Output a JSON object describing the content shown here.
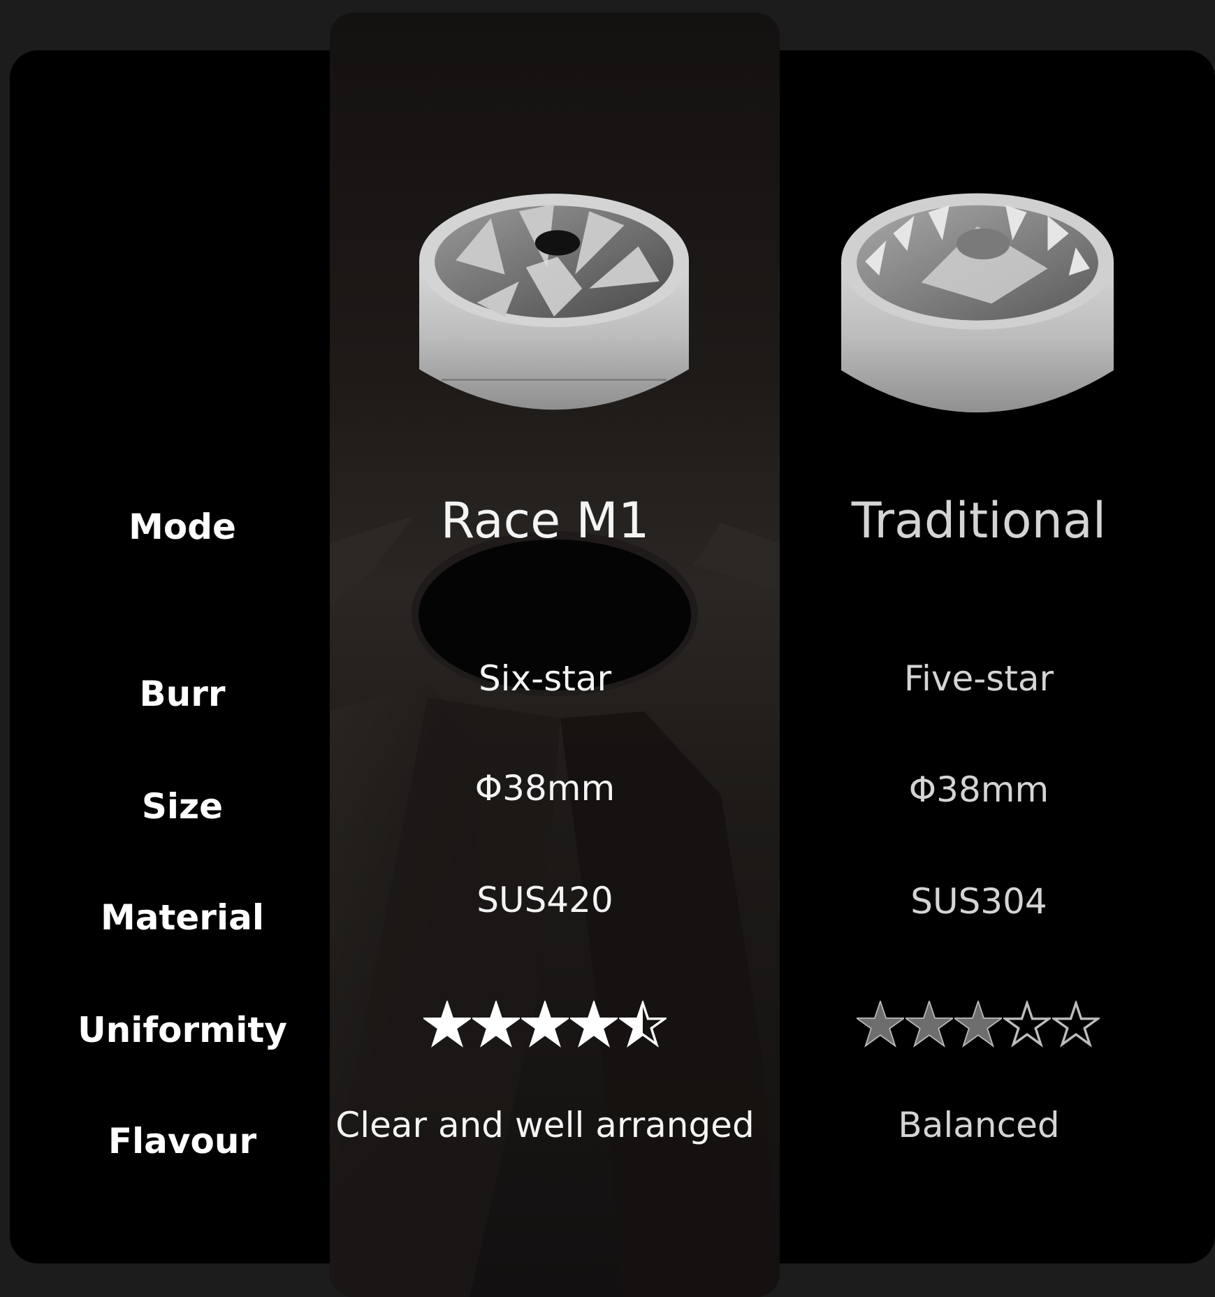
{
  "labels": {
    "mode": "Mode",
    "burr": "Burr",
    "size": "Size",
    "material": "Material",
    "uniformity": "Uniformity",
    "flavour": "Flavour"
  },
  "race_m1": {
    "name": "Race M1",
    "burr": "Six-star",
    "size": "Φ38mm",
    "material": "SUS420",
    "uniformity_stars": 4.5,
    "flavour": "Clear and well arranged"
  },
  "traditional": {
    "name": "Traditional",
    "burr": "Five-star",
    "size": "Φ38mm",
    "material": "SUS304",
    "uniformity_stars": 3,
    "flavour": "Balanced"
  },
  "colors": {
    "page_background": "#1c1c1c",
    "card_background": "#000000",
    "label_text": "#ffffff",
    "race_text": "#f4f4f4",
    "traditional_text": "#d4d4d4",
    "race_star_fill": "#ffffff",
    "traditional_star_fill": "#6e6e6e"
  }
}
